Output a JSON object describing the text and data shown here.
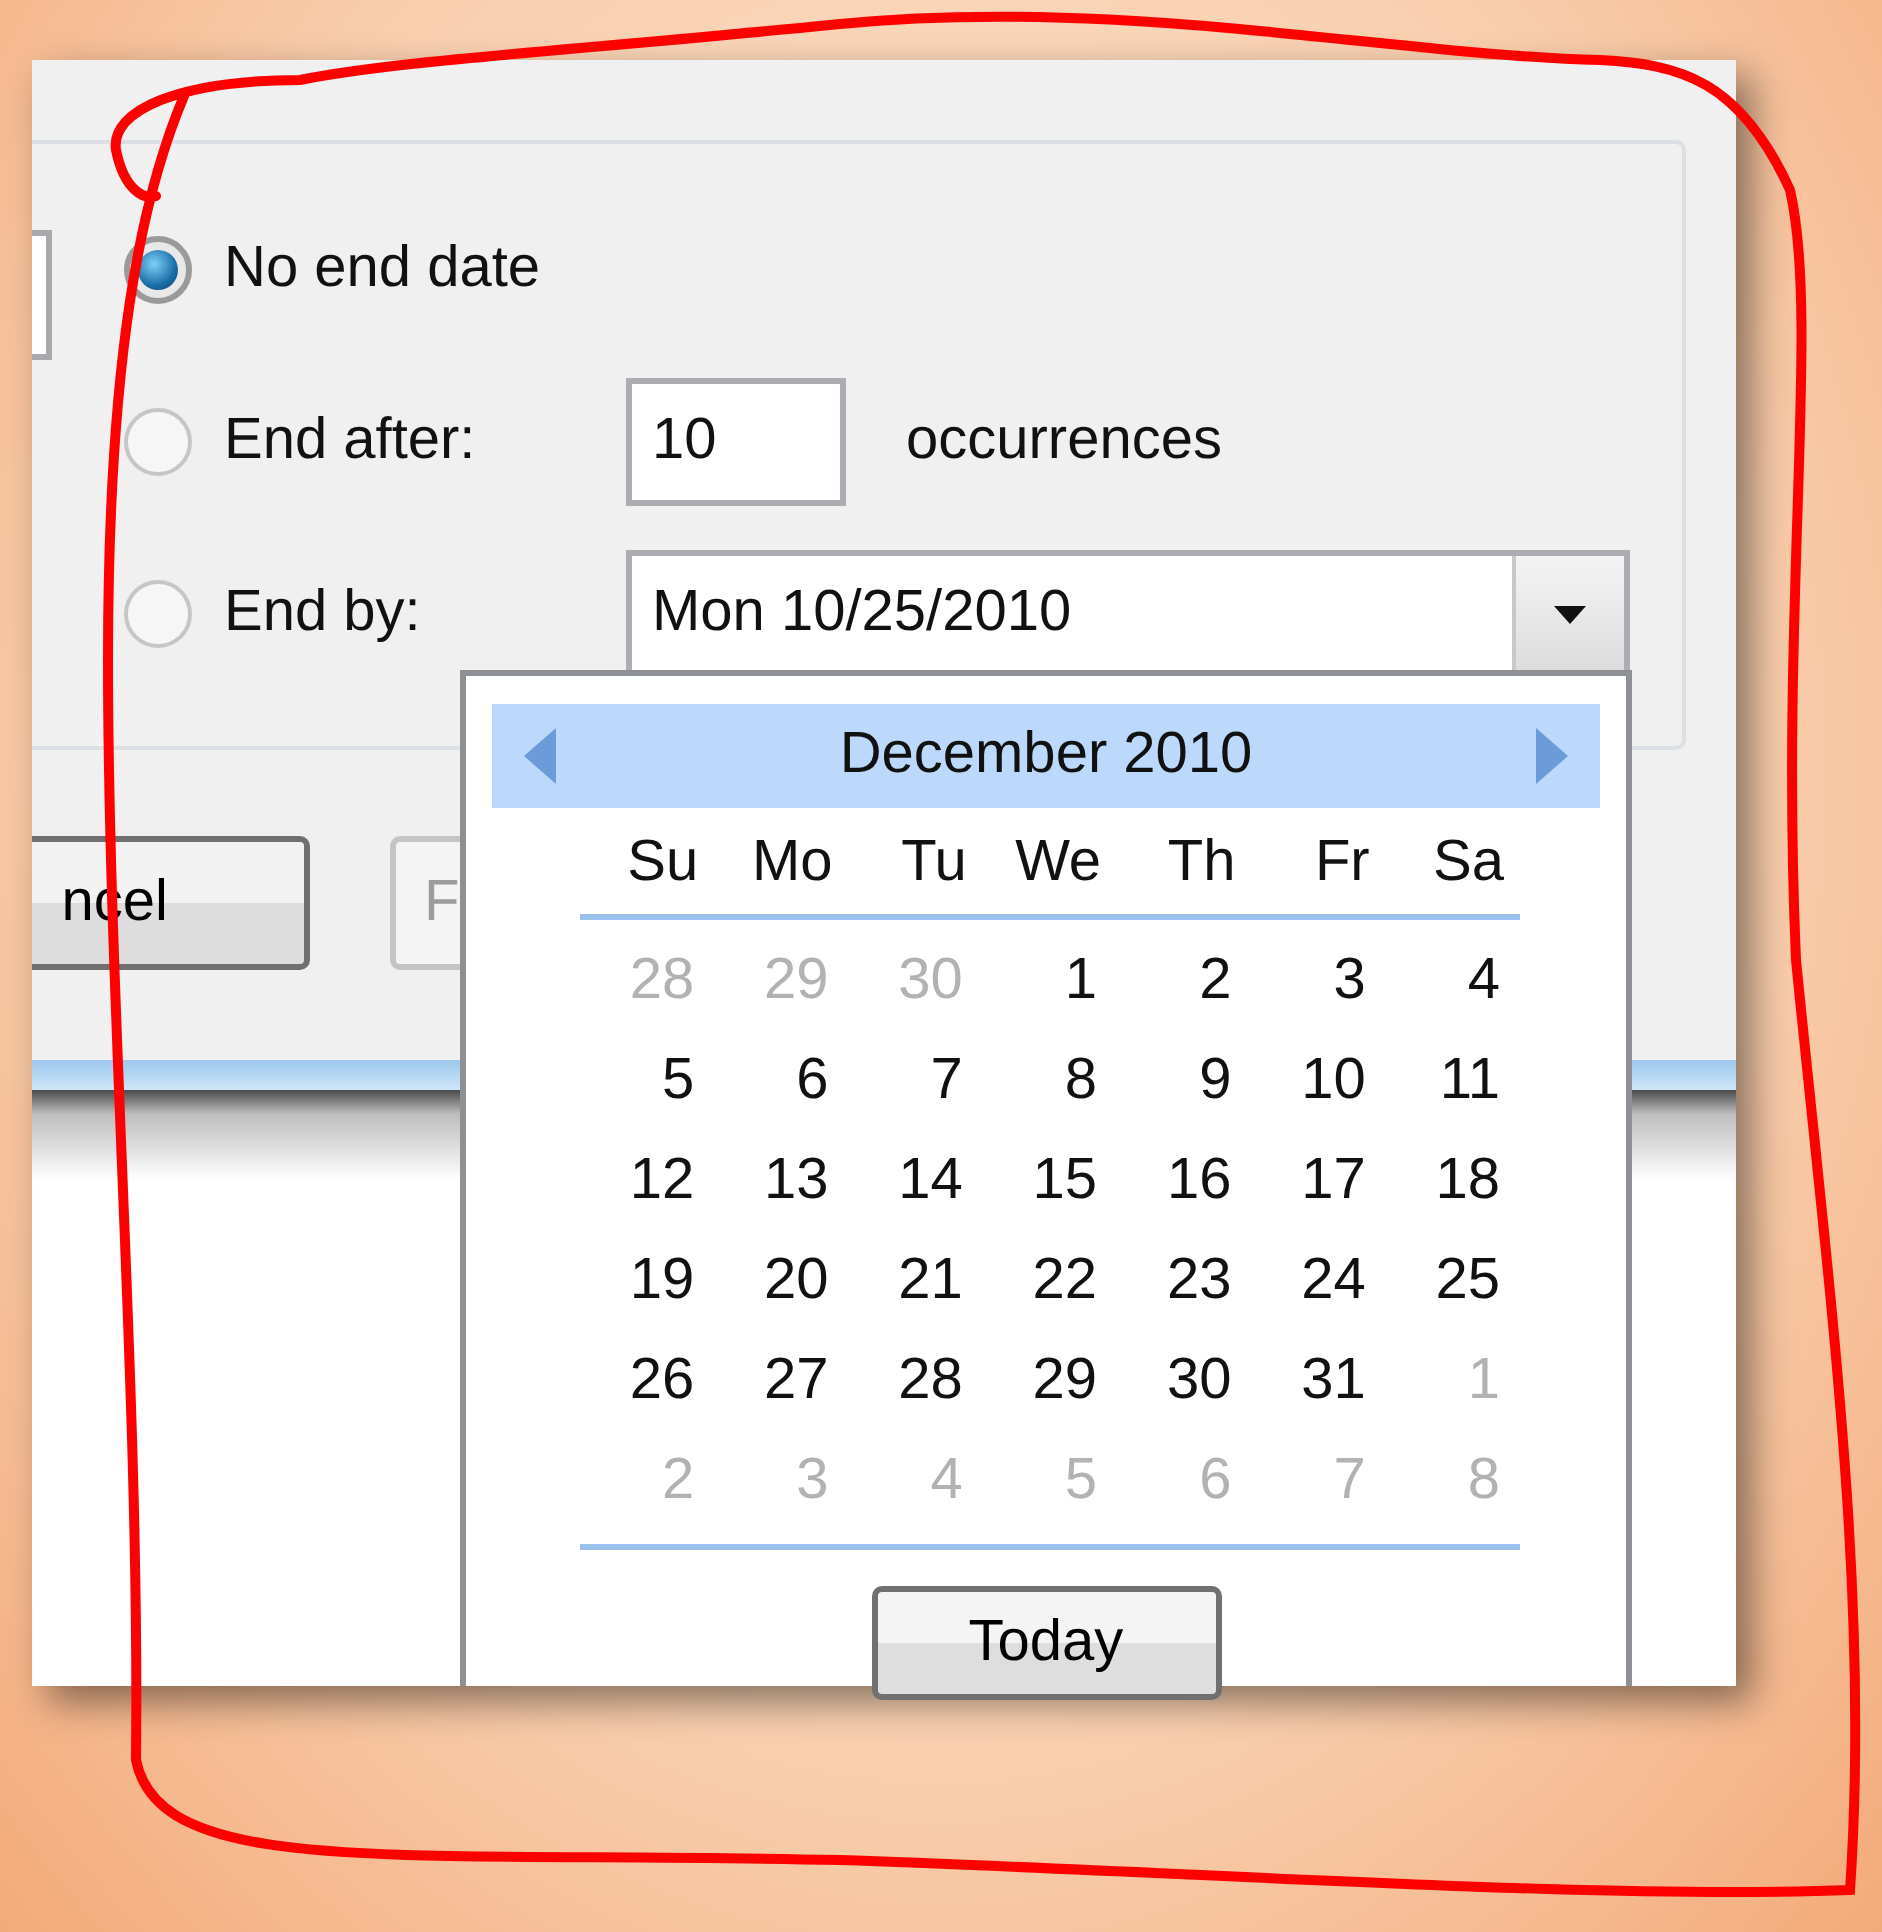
{
  "options": [
    {
      "kind": "plain",
      "label": "No end date",
      "selected": true
    },
    {
      "kind": "count",
      "label": "End after:",
      "selected": false,
      "value": "10",
      "suffix": "occurrences"
    },
    {
      "kind": "date",
      "label": "End by:",
      "selected": false,
      "value": "Mon 10/25/2010"
    }
  ],
  "buttons": [
    {
      "label": "ncel",
      "disabled": false
    },
    {
      "label": "F",
      "disabled": true
    }
  ],
  "calendar": {
    "title": "December 2010",
    "weekdays": [
      "Su",
      "Mo",
      "Tu",
      "We",
      "Th",
      "Fr",
      "Sa"
    ],
    "days": [
      {
        "day": "28",
        "other_month": true
      },
      {
        "day": "29",
        "other_month": true
      },
      {
        "day": "30",
        "other_month": true
      },
      {
        "day": "1",
        "other_month": false
      },
      {
        "day": "2",
        "other_month": false
      },
      {
        "day": "3",
        "other_month": false
      },
      {
        "day": "4",
        "other_month": false
      },
      {
        "day": "5",
        "other_month": false
      },
      {
        "day": "6",
        "other_month": false
      },
      {
        "day": "7",
        "other_month": false
      },
      {
        "day": "8",
        "other_month": false
      },
      {
        "day": "9",
        "other_month": false
      },
      {
        "day": "10",
        "other_month": false
      },
      {
        "day": "11",
        "other_month": false
      },
      {
        "day": "12",
        "other_month": false
      },
      {
        "day": "13",
        "other_month": false
      },
      {
        "day": "14",
        "other_month": false
      },
      {
        "day": "15",
        "other_month": false
      },
      {
        "day": "16",
        "other_month": false
      },
      {
        "day": "17",
        "other_month": false
      },
      {
        "day": "18",
        "other_month": false
      },
      {
        "day": "19",
        "other_month": false
      },
      {
        "day": "20",
        "other_month": false
      },
      {
        "day": "21",
        "other_month": false
      },
      {
        "day": "22",
        "other_month": false
      },
      {
        "day": "23",
        "other_month": false
      },
      {
        "day": "24",
        "other_month": false
      },
      {
        "day": "25",
        "other_month": false
      },
      {
        "day": "26",
        "other_month": false
      },
      {
        "day": "27",
        "other_month": false
      },
      {
        "day": "28",
        "other_month": false
      },
      {
        "day": "29",
        "other_month": false
      },
      {
        "day": "30",
        "other_month": false
      },
      {
        "day": "31",
        "other_month": false
      },
      {
        "day": "1",
        "other_month": true
      },
      {
        "day": "2",
        "other_month": true
      },
      {
        "day": "3",
        "other_month": true
      },
      {
        "day": "4",
        "other_month": true
      },
      {
        "day": "5",
        "other_month": true
      },
      {
        "day": "6",
        "other_month": true
      },
      {
        "day": "7",
        "other_month": true
      },
      {
        "day": "8",
        "other_month": true
      }
    ],
    "today_button": "Today"
  }
}
